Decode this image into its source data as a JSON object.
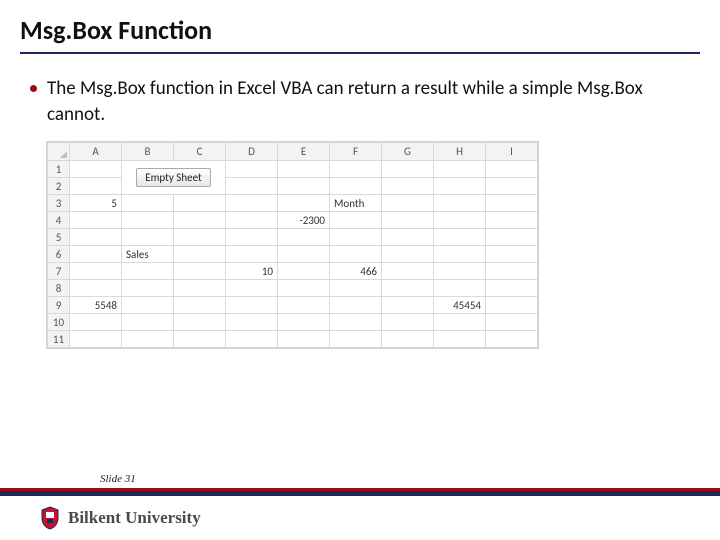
{
  "title": "Msg.Box Function",
  "bullet": "The Msg.Box function in Excel VBA can return a result while a simple Msg.Box cannot.",
  "sheet": {
    "columns": [
      "A",
      "B",
      "C",
      "D",
      "E",
      "F",
      "G",
      "H",
      "I"
    ],
    "rows": [
      "1",
      "2",
      "3",
      "4",
      "5",
      "6",
      "7",
      "8",
      "9",
      "10",
      "11"
    ],
    "button_label": "Empty Sheet",
    "cells": {
      "A3": "5",
      "F3": "Month",
      "E4": "-2300",
      "B6": "Sales",
      "D7": "10",
      "F7": "466",
      "A9": "5548",
      "H9": "45454"
    }
  },
  "footer": {
    "slide_label": "Slide 31",
    "university": "Bilkent University"
  }
}
